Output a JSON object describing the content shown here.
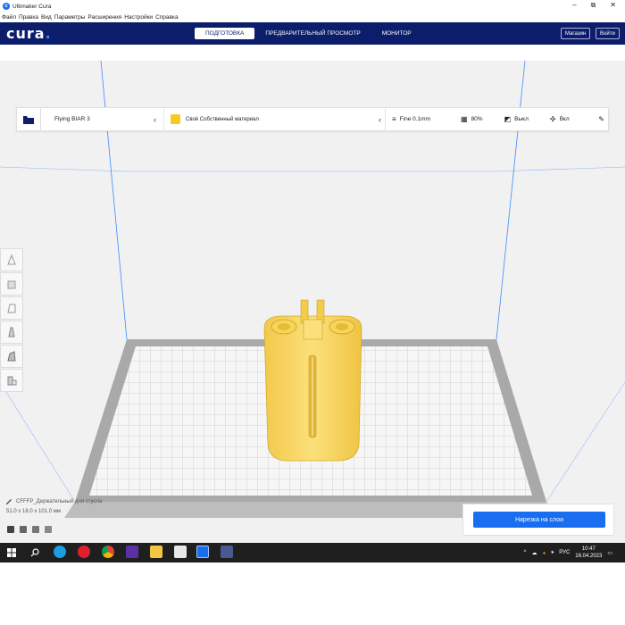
{
  "window": {
    "title": "Ultimaker Cura",
    "minimize": "–",
    "maximize": "⧉",
    "close": "✕"
  },
  "menu": [
    "Файл",
    "Правка",
    "Вид",
    "Параметры",
    "Расширения",
    "Настройки",
    "Справка"
  ],
  "header": {
    "logo_text": "cura",
    "logo_dot": ".",
    "tabs": [
      {
        "label": "ПОДГОТОВКА",
        "active": true
      },
      {
        "label": "ПРЕДВАРИТЕЛЬНЫЙ ПРОСМОТР",
        "active": false
      },
      {
        "label": "МОНИТОР",
        "active": false
      }
    ],
    "marketplace_label": "Магазин",
    "signin_label": "Войти"
  },
  "toolbar": {
    "printer": "Flying BIAR 3",
    "material": "Своё Собственный материал",
    "profile": "Fine 0.1mm",
    "infill": "80%",
    "support": "Выкл",
    "adhesion": "Вкл"
  },
  "object": {
    "name": "CFFFP_Держательный для стусла",
    "dimensions": "51.0 x 18.0 x 101.0 мм"
  },
  "slice": {
    "button_label": "Нарезка на слои"
  },
  "taskbar": {
    "lang": "РУС",
    "time": "10:47",
    "date": "16.04.2023"
  },
  "colors": {
    "header_bg": "#0c1d6b",
    "accent": "#196ef0",
    "model": "#f7d556",
    "taskbar": "#1f1f1f"
  }
}
